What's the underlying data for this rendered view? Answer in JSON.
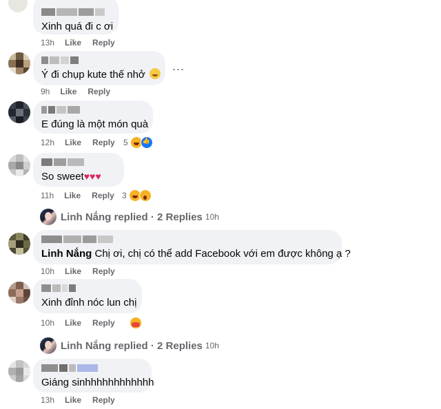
{
  "comments": [
    {
      "text": "Xinh quá đi c ơi",
      "time": "13h",
      "like": "Like",
      "reply": "Reply"
    },
    {
      "text": "Ý đi chụp kute thế nhở",
      "emoji": "blushing-face",
      "time": "9h",
      "like": "Like",
      "reply": "Reply",
      "more": "..."
    },
    {
      "text": "E đúng là một món quà",
      "time": "12h",
      "like": "Like",
      "reply": "Reply",
      "reaction_count": "5",
      "reactions": [
        "haha",
        "like"
      ]
    },
    {
      "text": "So sweet",
      "hearts": "♥♥♥",
      "time": "11h",
      "like": "Like",
      "reply": "Reply",
      "reaction_count": "3",
      "reactions": [
        "haha",
        "wow"
      ]
    },
    {
      "tag": "Linh Nắng",
      "text": "Chị ơi, chị có thể add Facebook với em được không ạ ?",
      "time": "10h",
      "like": "Like",
      "reply": "Reply"
    },
    {
      "text": "Xinh đỉnh nóc lun chị",
      "time": "10h",
      "like": "Like",
      "reply": "Reply",
      "reactions": [
        "care"
      ]
    },
    {
      "text": "Giáng sinhhhhhhhhhhhh",
      "time": "13h",
      "like": "Like",
      "reply": "Reply"
    }
  ],
  "replies": [
    {
      "author": "Linh Nắng",
      "label": "replied · 2 Replies",
      "time": "10h"
    },
    {
      "author": "Linh Nắng",
      "label": "replied · 2 Replies",
      "time": "10h"
    }
  ],
  "colors": {
    "bubble": "#f0f2f5",
    "meta": "#65676b",
    "text": "#050505"
  }
}
